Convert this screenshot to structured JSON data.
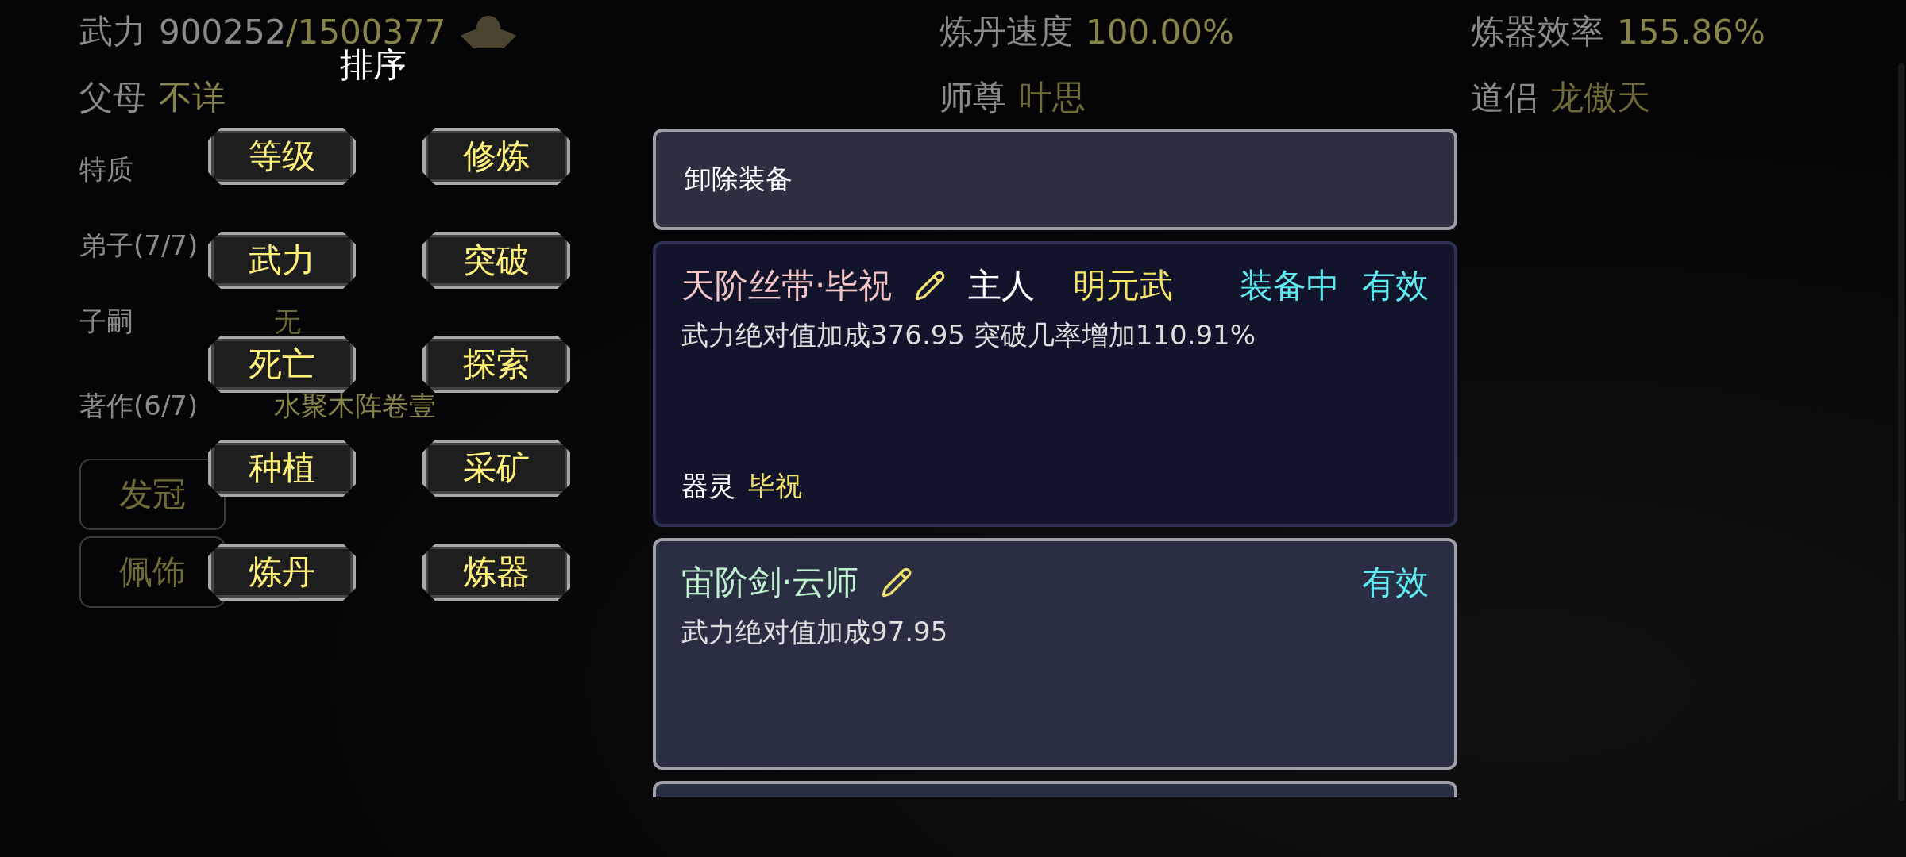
{
  "stats": [
    {
      "label": "武力",
      "value": "900252",
      "max": "/1500377"
    },
    {
      "label": "炼丹速度",
      "value": "100.00%"
    },
    {
      "label": "炼器效率",
      "value": "155.86%"
    }
  ],
  "relations": [
    {
      "label": "父母",
      "value": "不详"
    },
    {
      "label": "师尊",
      "value": "叶思"
    },
    {
      "label": "道侣",
      "value": "龙傲天"
    }
  ],
  "profile_rows": [
    {
      "label": "特质"
    },
    {
      "label": "弟子(7/7)"
    },
    {
      "label": "子嗣",
      "value": "无"
    },
    {
      "label": "著作(6/7)",
      "value": "水聚木阵卷壹"
    }
  ],
  "slots": [
    "发冠",
    "佩饰"
  ],
  "sort_menu": {
    "title": "排序",
    "options": [
      "等级",
      "修炼",
      "武力",
      "突破",
      "死亡",
      "探索",
      "种植",
      "采矿",
      "炼丹",
      "炼器"
    ]
  },
  "equipment": {
    "unequip_label": "卸除装备",
    "items": [
      {
        "name": "天阶丝带·毕祝",
        "color": "#f4c4c6",
        "owner_label": "主人",
        "owner": "明元武",
        "status": "装备中",
        "validity": "有效",
        "equipped": true,
        "effect": "武力绝对值加成376.95 突破几率增加110.91%",
        "spirit_label": "器灵",
        "spirit": "毕祝"
      },
      {
        "name": "宙阶剑·云师",
        "color": "#bff0cf",
        "validity": "有效",
        "equipped": false,
        "effect": "武力绝对值加成97.95"
      }
    ]
  }
}
